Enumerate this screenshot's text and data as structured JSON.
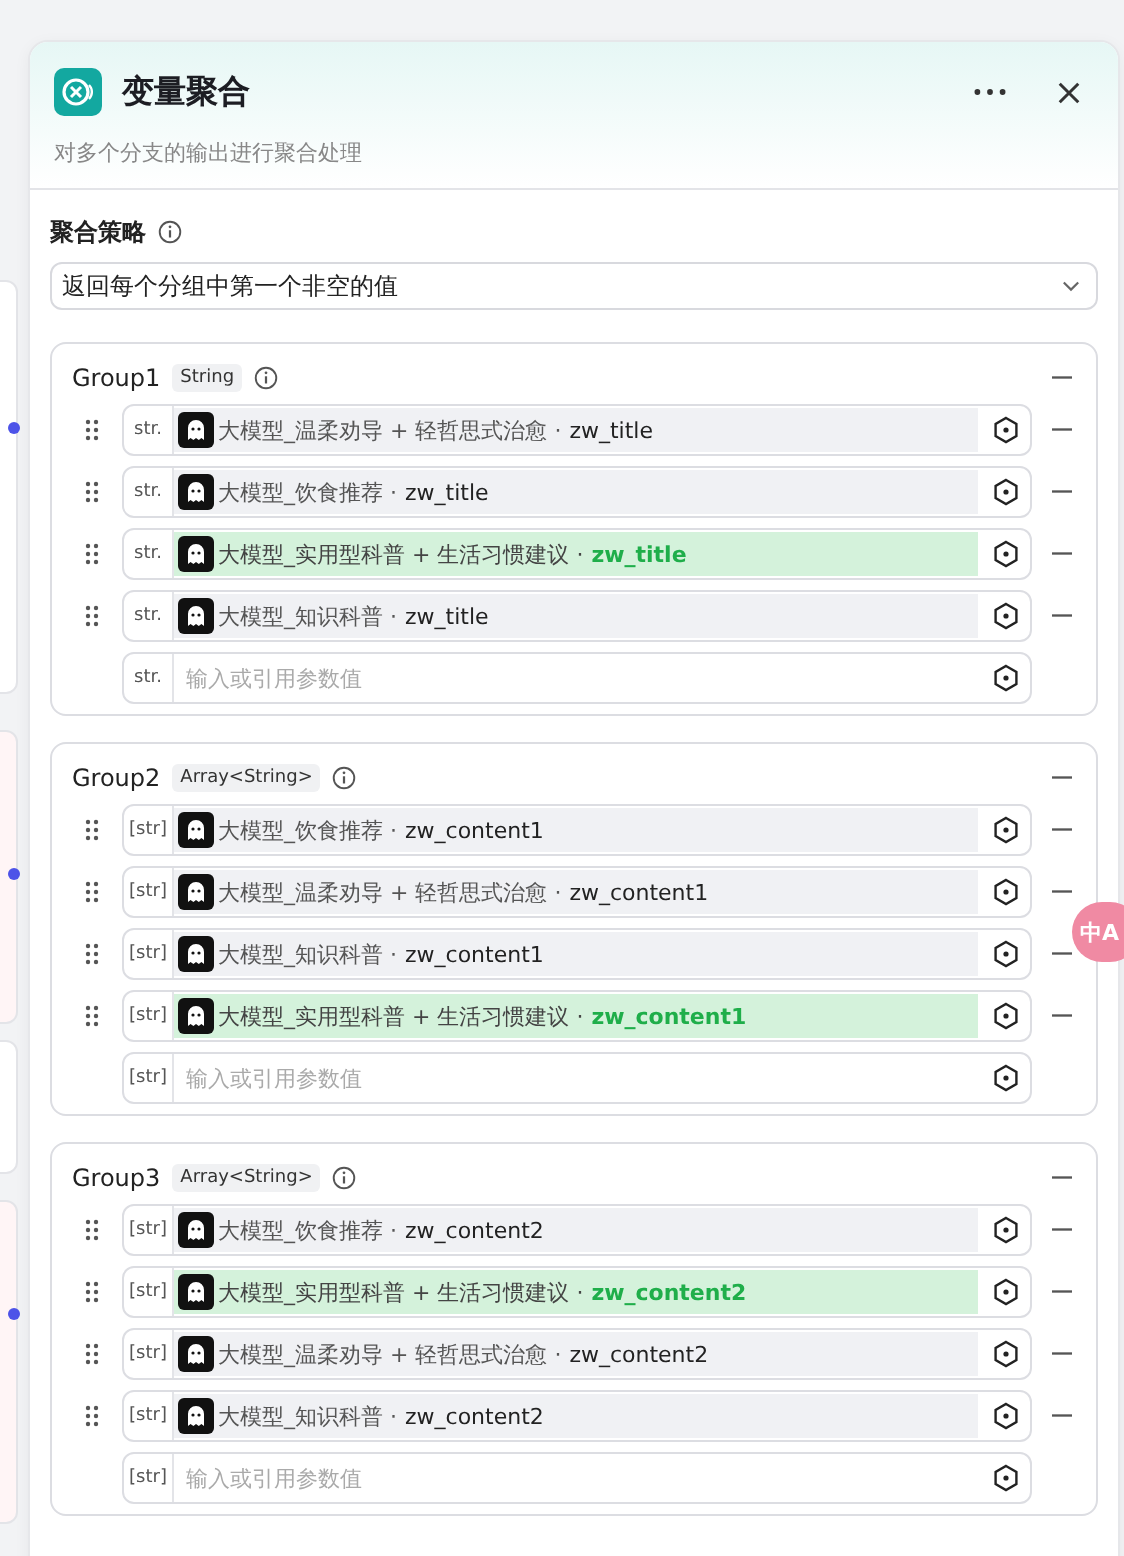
{
  "panel": {
    "title": "变量聚合",
    "description": "对多个分支的输出进行聚合处理"
  },
  "strategy": {
    "label": "聚合策略",
    "value": "返回每个分组中第一个非空的值"
  },
  "groups": [
    {
      "name": "Group1",
      "type": "String",
      "items": [
        {
          "prefix": "str.",
          "source": "大模型_温柔劝导 + 轻哲思式治愈 ·",
          "variable": "zw_title",
          "selected": false
        },
        {
          "prefix": "str.",
          "source": "大模型_饮食推荐 ·",
          "variable": "zw_title",
          "selected": false
        },
        {
          "prefix": "str.",
          "source": "大模型_实用型科普 + 生活习惯建议 ·",
          "variable": "zw_title",
          "selected": true
        },
        {
          "prefix": "str.",
          "source": "大模型_知识科普 ·",
          "variable": "zw_title",
          "selected": false
        }
      ],
      "input": {
        "prefix": "str.",
        "placeholder": "输入或引用参数值"
      }
    },
    {
      "name": "Group2",
      "type": "Array<String>",
      "items": [
        {
          "prefix": "[str]",
          "source": "大模型_饮食推荐 ·",
          "variable": "zw_content1",
          "selected": false
        },
        {
          "prefix": "[str]",
          "source": "大模型_温柔劝导 + 轻哲思式治愈 ·",
          "variable": "zw_content1",
          "selected": false
        },
        {
          "prefix": "[str]",
          "source": "大模型_知识科普 ·",
          "variable": "zw_content1",
          "selected": false
        },
        {
          "prefix": "[str]",
          "source": "大模型_实用型科普 + 生活习惯建议 ·",
          "variable": "zw_content1",
          "selected": true
        }
      ],
      "input": {
        "prefix": "[str]",
        "placeholder": "输入或引用参数值"
      }
    },
    {
      "name": "Group3",
      "type": "Array<String>",
      "items": [
        {
          "prefix": "[str]",
          "source": "大模型_饮食推荐 ·",
          "variable": "zw_content2",
          "selected": false
        },
        {
          "prefix": "[str]",
          "source": "大模型_实用型科普 + 生活习惯建议 ·",
          "variable": "zw_content2",
          "selected": true
        },
        {
          "prefix": "[str]",
          "source": "大模型_温柔劝导 + 轻哲思式治愈 ·",
          "variable": "zw_content2",
          "selected": false
        },
        {
          "prefix": "[str]",
          "source": "大模型_知识科普 ·",
          "variable": "zw_content2",
          "selected": false
        }
      ],
      "input": {
        "prefix": "[str]",
        "placeholder": "输入或引用参数值"
      }
    }
  ],
  "translate_badge": {
    "label": "中A"
  }
}
